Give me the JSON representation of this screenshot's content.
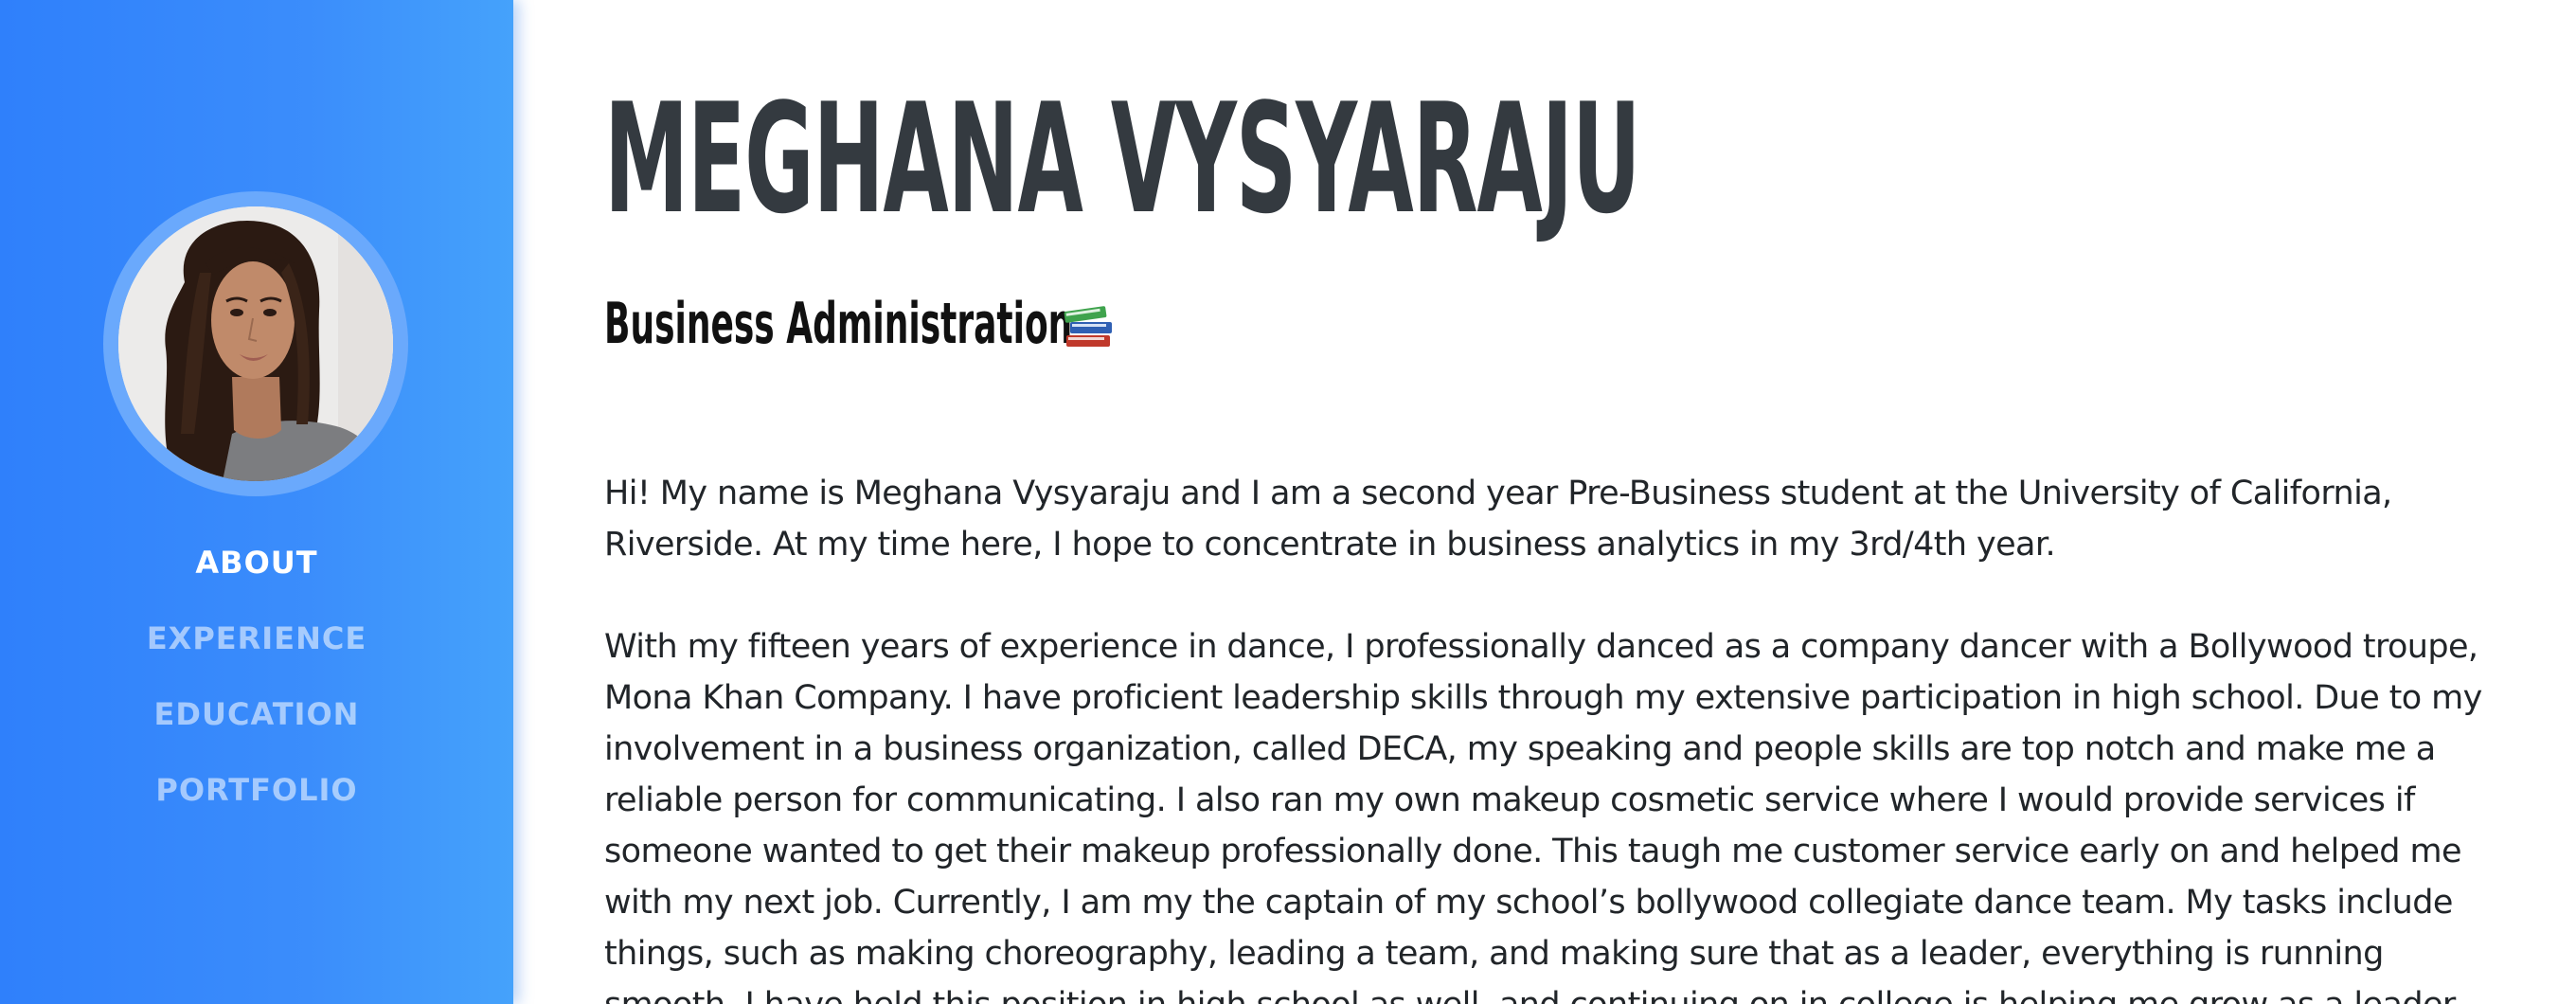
{
  "profile": {
    "avatar_alt": "profile photo"
  },
  "nav": {
    "items": [
      {
        "label": "ABOUT",
        "active": true
      },
      {
        "label": "EXPERIENCE",
        "active": false
      },
      {
        "label": "EDUCATION",
        "active": false
      },
      {
        "label": "PORTFOLIO",
        "active": false
      }
    ]
  },
  "header": {
    "name": "MEGHANA VYSYARAJU",
    "subtitle": "Business Administration",
    "subtitle_icon": "books-emoji"
  },
  "about": {
    "paragraph1": "Hi! My name is Meghana Vysyaraju and I am a second year Pre-Business student at the University of California, Riverside. At my time here, I hope to concentrate in business analytics in my 3rd/4th year.",
    "paragraph2": "With my fifteen years of experience in dance, I professionally danced as a company dancer with a Bollywood troupe, Mona Khan Company. I have proficient leadership skills through my extensive participation in high school. Due to my involvement in a business organization, called DECA, my speaking and people skills are top notch and make me a reliable person for communicating. I also ran my own makeup cosmetic service where I would provide services if someone wanted to get their makeup professionally done. This taugh me customer service early on and helped me with my next job. Currently, I am my the captain of my school’s bollywood collegiate dance team. My tasks include things, such as making choreography, leading a team, and making sure that as a leader, everything is running smooth. I have held this position in high school as well, and continuing on in college is helping me grow as a leader."
  },
  "colors": {
    "sidebar_start": "#2f80fb",
    "sidebar_end": "#45a2fb",
    "heading": "#343a40",
    "body_text": "#212529",
    "nav_active": "#ffffff"
  }
}
